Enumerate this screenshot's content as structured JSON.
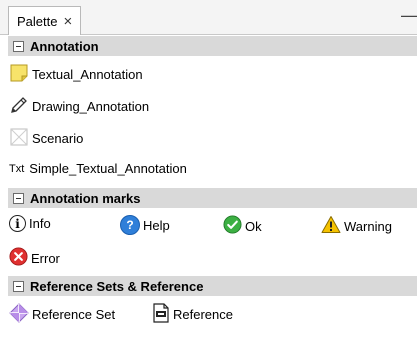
{
  "tab": {
    "label": "Palette",
    "close_glyph": "×",
    "minimize_glyph": "—"
  },
  "sections": [
    {
      "title": "Annotation",
      "items": [
        {
          "label": "Textual_Annotation",
          "icon": "note-icon"
        },
        {
          "label": "Drawing_Annotation",
          "icon": "pencil-icon"
        },
        {
          "label": "Scenario",
          "icon": "scenario-icon"
        },
        {
          "label": "Simple_Textual_Annotation",
          "icon": "txt-icon",
          "icon_text": "Txt"
        }
      ]
    },
    {
      "title": "Annotation marks",
      "items": [
        {
          "label": "Info",
          "icon": "info-icon"
        },
        {
          "label": "Help",
          "icon": "help-icon"
        },
        {
          "label": "Ok",
          "icon": "ok-icon"
        },
        {
          "label": "Warning",
          "icon": "warning-icon"
        },
        {
          "label": "Error",
          "icon": "error-icon"
        }
      ]
    },
    {
      "title": "Reference Sets & Reference",
      "items": [
        {
          "label": "Reference Set",
          "icon": "reference-set-icon"
        },
        {
          "label": "Reference",
          "icon": "reference-icon"
        }
      ]
    }
  ],
  "colors": {
    "section_header_bg": "#d9d9d9",
    "help_blue": "#2f7fd9",
    "ok_green": "#3cb043",
    "warning_yellow": "#f5c200",
    "error_red": "#e03030",
    "note_yellow": "#f7e36a"
  }
}
